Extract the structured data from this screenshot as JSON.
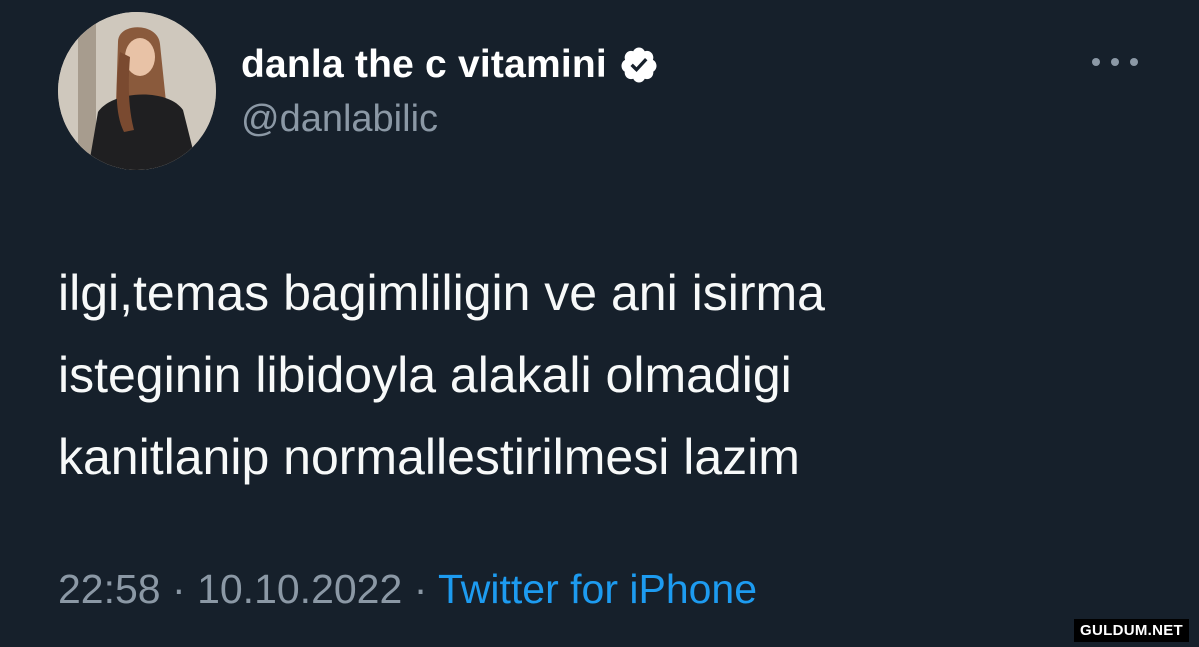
{
  "tweet": {
    "display_name": "danla the c vitamini",
    "handle": "@danlabilic",
    "verified_icon": "verified-badge-icon",
    "more_icon": "more-options-icon",
    "text_lines": [
      "ilgi,temas bagimliligin ve ani isirma",
      "isteginin libidoyla alakali olmadigi",
      "kanitlanip normallestirilmesi lazim"
    ],
    "time": "22:58",
    "separator": "·",
    "date": "10.10.2022",
    "source": "Twitter for iPhone"
  },
  "watermark": "GULDUM.NET",
  "colors": {
    "background": "#16202b",
    "text": "#f7f9f9",
    "muted": "#8b98a5",
    "link": "#1d9bf0"
  }
}
